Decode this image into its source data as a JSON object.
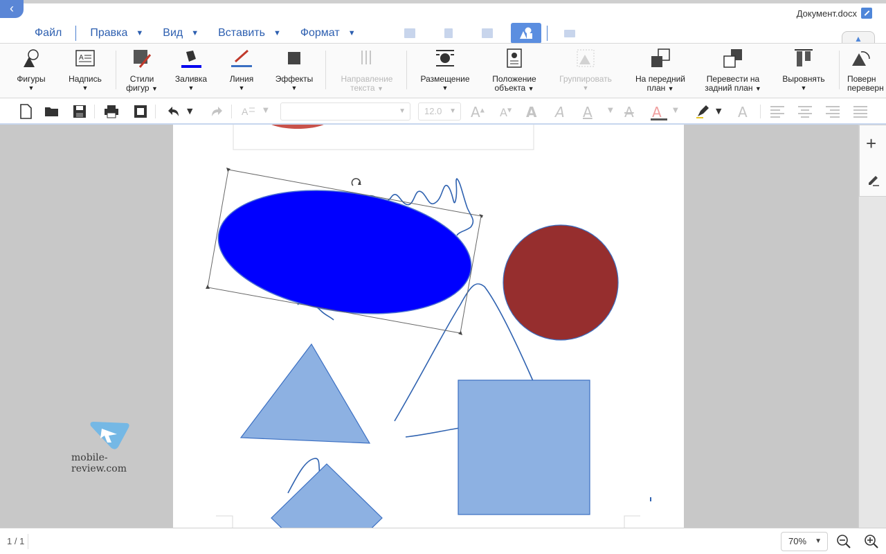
{
  "window": {
    "document_title": "Документ.docx"
  },
  "menu": {
    "items": [
      {
        "label": "Файл",
        "has_dropdown": false
      },
      {
        "label": "Правка",
        "has_dropdown": true
      },
      {
        "label": "Вид",
        "has_dropdown": true
      },
      {
        "label": "Вставить",
        "has_dropdown": true
      },
      {
        "label": "Формат",
        "has_dropdown": true
      }
    ],
    "mode_icons": [
      "table-icon",
      "chart-icon",
      "image-icon",
      "shape-icon",
      "textbox-icon"
    ],
    "active_mode": "shape-icon"
  },
  "ribbon": {
    "items": [
      {
        "label1": "Фигуры",
        "label2": "",
        "icon": "shapes-icon",
        "enabled": true
      },
      {
        "label1": "Надпись",
        "label2": "",
        "icon": "textbox-icon",
        "enabled": true
      },
      {
        "label1": "Стили",
        "label2": "фигур",
        "icon": "shape-styles-icon",
        "enabled": true
      },
      {
        "label1": "Заливка",
        "label2": "",
        "icon": "fill-icon",
        "enabled": true
      },
      {
        "label1": "Линия",
        "label2": "",
        "icon": "line-icon",
        "enabled": true
      },
      {
        "label1": "Эффекты",
        "label2": "",
        "icon": "effects-icon",
        "enabled": true
      },
      {
        "label1": "Направление",
        "label2": "текста",
        "icon": "text-direction-icon",
        "enabled": false
      },
      {
        "label1": "Размещение",
        "label2": "",
        "icon": "wrap-icon",
        "enabled": true
      },
      {
        "label1": "Положение",
        "label2": "объекта",
        "icon": "position-icon",
        "enabled": true
      },
      {
        "label1": "Группировать",
        "label2": "",
        "icon": "group-icon",
        "enabled": false
      },
      {
        "label1": "На передний",
        "label2": "план",
        "icon": "bring-forward-icon",
        "enabled": true
      },
      {
        "label1": "Перевести на",
        "label2": "задний план",
        "icon": "send-backward-icon",
        "enabled": true
      },
      {
        "label1": "Выровнять",
        "label2": "",
        "icon": "align-icon",
        "enabled": true
      },
      {
        "label1": "Поверн",
        "label2": "переверн",
        "icon": "rotate-icon",
        "enabled": true
      }
    ]
  },
  "format_toolbar": {
    "font_name": "",
    "font_size": "12.0"
  },
  "colors": {
    "accent": "#4f86d9",
    "menu_text": "#2d5fb0",
    "ellipse_fill": "#0000ff",
    "circle_fill": "#962e2e",
    "shape_fill": "#8db1e2",
    "shape_stroke": "#3b6fc2",
    "ink": "#2f62b0"
  },
  "status": {
    "page_indicator": "1 / 1",
    "zoom": "70%"
  },
  "watermark": {
    "text": "mobile-review.com"
  }
}
